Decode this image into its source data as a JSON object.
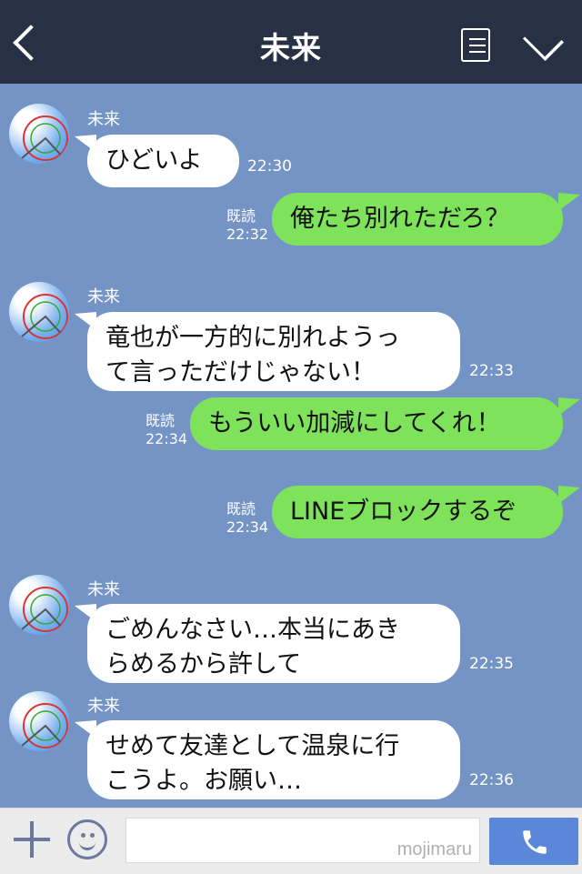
{
  "header": {
    "title": "未来"
  },
  "messages": [
    {
      "sender": "未来",
      "text_lines": [
        "ひどいよ"
      ],
      "time": "22:30"
    },
    {
      "text_lines": [
        "俺たち別れただろ？"
      ],
      "read": "既読",
      "time": "22:32"
    },
    {
      "sender": "未来",
      "text_lines": [
        "竜也が一方的に別れようっ",
        "て言っただけじゃない！"
      ],
      "time": "22:33"
    },
    {
      "text_lines": [
        "もういい加減にしてくれ！"
      ],
      "read": "既読",
      "time": "22:34"
    },
    {
      "text_lines": [
        "LINEブロックするぞ"
      ],
      "read": "既読",
      "time": "22:34"
    },
    {
      "sender": "未来",
      "text_lines": [
        "ごめんなさい…本当にあき",
        "らめるから許して"
      ],
      "time": "22:35"
    },
    {
      "sender": "未来",
      "text_lines": [
        "せめて友達として温泉に行",
        "こうよ。お願い…"
      ],
      "time": "22:36"
    }
  ],
  "footer": {
    "watermark": "mojimaru"
  },
  "colors": {
    "header_bg": "#283046",
    "chat_bg": "#7394c4",
    "outgoing_bubble": "#7ee35a",
    "incoming_bubble": "#ffffff"
  },
  "icons": [
    "back-icon",
    "note-icon",
    "chevron-down-icon",
    "plus-icon",
    "smile-icon",
    "phone-icon"
  ]
}
